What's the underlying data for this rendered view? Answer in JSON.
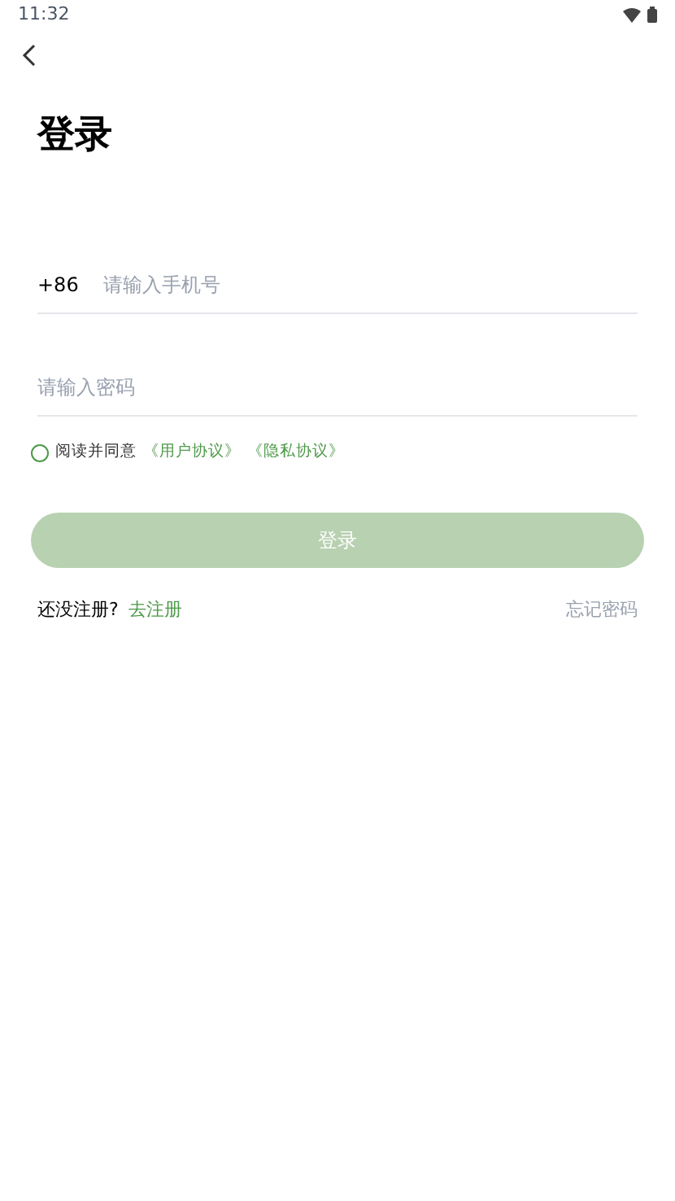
{
  "status_bar": {
    "time": "11:32"
  },
  "title": "登录",
  "phone_field": {
    "prefix": "+86",
    "placeholder": "请输入手机号"
  },
  "password_field": {
    "placeholder": "请输入密码"
  },
  "agreement": {
    "checked": false,
    "text": "阅读并同意",
    "links": [
      "《用户协议》",
      "《隐私协议》"
    ]
  },
  "login_button": {
    "label": "登录",
    "disabled": true
  },
  "register_prompt": "还没注册?",
  "register_link": "去注册",
  "forgot_link": "忘记密码"
}
